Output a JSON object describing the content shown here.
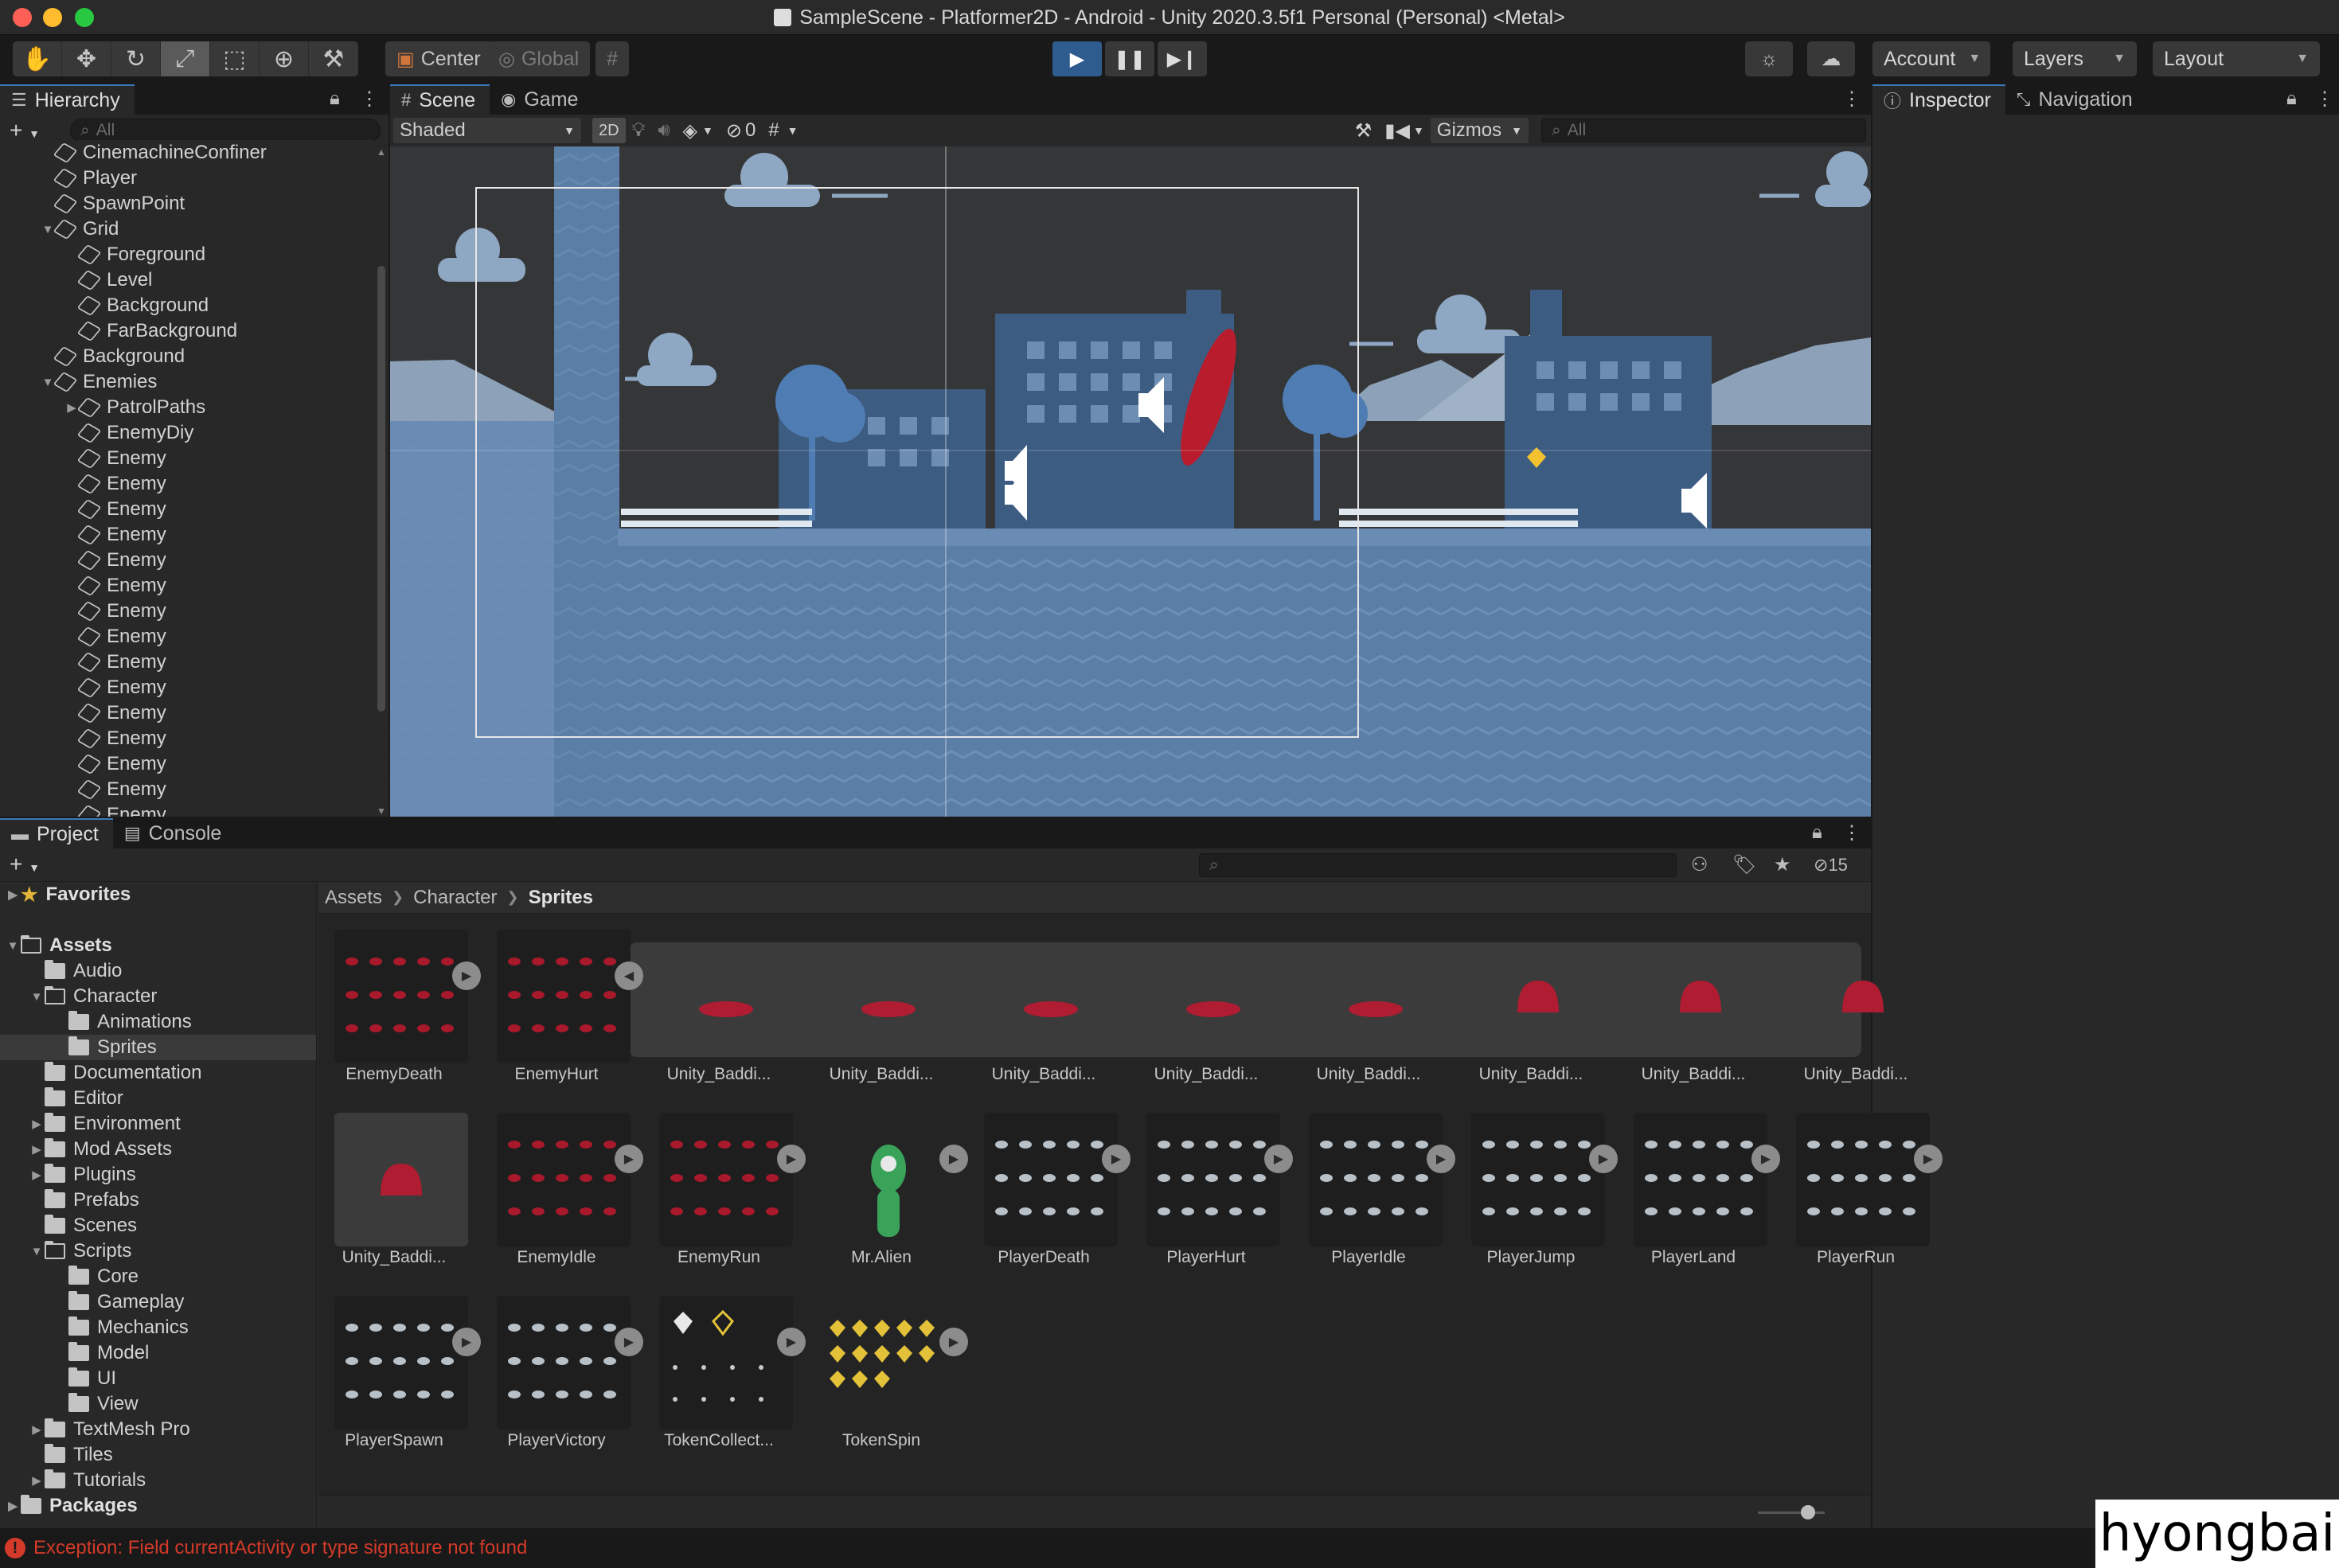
{
  "window": {
    "title": "SampleScene - Platformer2D - Android - Unity 2020.3.5f1 Personal (Personal) <Metal>"
  },
  "toolbar": {
    "center_label": "Center",
    "global_label": "Global",
    "account_label": "Account",
    "layers_label": "Layers",
    "layout_label": "Layout"
  },
  "hierarchy": {
    "tab_label": "Hierarchy",
    "search_placeholder": "All",
    "items": [
      {
        "label": "CinemachineConfiner",
        "depth": 1,
        "arrow": ""
      },
      {
        "label": "Player",
        "depth": 1,
        "arrow": ""
      },
      {
        "label": "SpawnPoint",
        "depth": 1,
        "arrow": ""
      },
      {
        "label": "Grid",
        "depth": 1,
        "arrow": "▼"
      },
      {
        "label": "Foreground",
        "depth": 2,
        "arrow": ""
      },
      {
        "label": "Level",
        "depth": 2,
        "arrow": ""
      },
      {
        "label": "Background",
        "depth": 2,
        "arrow": ""
      },
      {
        "label": "FarBackground",
        "depth": 2,
        "arrow": ""
      },
      {
        "label": "Background",
        "depth": 1,
        "arrow": ""
      },
      {
        "label": "Enemies",
        "depth": 1,
        "arrow": "▼"
      },
      {
        "label": "PatrolPaths",
        "depth": 2,
        "arrow": "▶"
      },
      {
        "label": "EnemyDiy",
        "depth": 2,
        "arrow": ""
      },
      {
        "label": "Enemy",
        "depth": 2,
        "arrow": ""
      },
      {
        "label": "Enemy",
        "depth": 2,
        "arrow": ""
      },
      {
        "label": "Enemy",
        "depth": 2,
        "arrow": ""
      },
      {
        "label": "Enemy",
        "depth": 2,
        "arrow": ""
      },
      {
        "label": "Enemy",
        "depth": 2,
        "arrow": ""
      },
      {
        "label": "Enemy",
        "depth": 2,
        "arrow": ""
      },
      {
        "label": "Enemy",
        "depth": 2,
        "arrow": ""
      },
      {
        "label": "Enemy",
        "depth": 2,
        "arrow": ""
      },
      {
        "label": "Enemy",
        "depth": 2,
        "arrow": ""
      },
      {
        "label": "Enemy",
        "depth": 2,
        "arrow": ""
      },
      {
        "label": "Enemy",
        "depth": 2,
        "arrow": ""
      },
      {
        "label": "Enemy",
        "depth": 2,
        "arrow": ""
      },
      {
        "label": "Enemy",
        "depth": 2,
        "arrow": ""
      },
      {
        "label": "Enemy",
        "depth": 2,
        "arrow": ""
      },
      {
        "label": "Enemy",
        "depth": 2,
        "arrow": ""
      }
    ]
  },
  "scene": {
    "tabs": [
      {
        "label": "Scene",
        "icon": "grid-icon"
      },
      {
        "label": "Game",
        "icon": "gamepad-icon"
      }
    ],
    "shading_mode": "Shaded",
    "mode_2d": "2D",
    "hidden_count": "0",
    "gizmos_label": "Gizmos",
    "search_placeholder": "All"
  },
  "inspector": {
    "tabs": [
      {
        "label": "Inspector",
        "icon": "info-icon"
      },
      {
        "label": "Navigation",
        "icon": "navigation-icon"
      }
    ]
  },
  "project": {
    "tabs": [
      {
        "label": "Project",
        "icon": "folder-icon"
      },
      {
        "label": "Console",
        "icon": "console-icon"
      }
    ],
    "hidden_count": "15",
    "tree": [
      {
        "label": "Favorites",
        "depth": 0,
        "arrow": "▶",
        "kind": "star",
        "bold": true
      },
      {
        "label": "",
        "depth": 0,
        "arrow": "",
        "kind": "spacer",
        "bold": false
      },
      {
        "label": "Assets",
        "depth": 0,
        "arrow": "▼",
        "kind": "open",
        "bold": true
      },
      {
        "label": "Audio",
        "depth": 1,
        "arrow": "",
        "kind": "folder",
        "bold": false
      },
      {
        "label": "Character",
        "depth": 1,
        "arrow": "▼",
        "kind": "open",
        "bold": false
      },
      {
        "label": "Animations",
        "depth": 2,
        "arrow": "",
        "kind": "folder",
        "bold": false
      },
      {
        "label": "Sprites",
        "depth": 2,
        "arrow": "",
        "kind": "folder",
        "bold": false,
        "selected": true
      },
      {
        "label": "Documentation",
        "depth": 1,
        "arrow": "",
        "kind": "folder",
        "bold": false
      },
      {
        "label": "Editor",
        "depth": 1,
        "arrow": "",
        "kind": "folder",
        "bold": false
      },
      {
        "label": "Environment",
        "depth": 1,
        "arrow": "▶",
        "kind": "folder",
        "bold": false
      },
      {
        "label": "Mod Assets",
        "depth": 1,
        "arrow": "▶",
        "kind": "folder",
        "bold": false
      },
      {
        "label": "Plugins",
        "depth": 1,
        "arrow": "▶",
        "kind": "folder",
        "bold": false
      },
      {
        "label": "Prefabs",
        "depth": 1,
        "arrow": "",
        "kind": "folder",
        "bold": false
      },
      {
        "label": "Scenes",
        "depth": 1,
        "arrow": "",
        "kind": "folder",
        "bold": false
      },
      {
        "label": "Scripts",
        "depth": 1,
        "arrow": "▼",
        "kind": "open",
        "bold": false
      },
      {
        "label": "Core",
        "depth": 2,
        "arrow": "",
        "kind": "folder",
        "bold": false
      },
      {
        "label": "Gameplay",
        "depth": 2,
        "arrow": "",
        "kind": "folder",
        "bold": false
      },
      {
        "label": "Mechanics",
        "depth": 2,
        "arrow": "",
        "kind": "folder",
        "bold": false
      },
      {
        "label": "Model",
        "depth": 2,
        "arrow": "",
        "kind": "folder",
        "bold": false
      },
      {
        "label": "UI",
        "depth": 2,
        "arrow": "",
        "kind": "folder",
        "bold": false
      },
      {
        "label": "View",
        "depth": 2,
        "arrow": "",
        "kind": "folder",
        "bold": false
      },
      {
        "label": "TextMesh Pro",
        "depth": 1,
        "arrow": "▶",
        "kind": "folder",
        "bold": false
      },
      {
        "label": "Tiles",
        "depth": 1,
        "arrow": "",
        "kind": "folder",
        "bold": false
      },
      {
        "label": "Tutorials",
        "depth": 1,
        "arrow": "▶",
        "kind": "folder",
        "bold": false
      },
      {
        "label": "Packages",
        "depth": 0,
        "arrow": "▶",
        "kind": "folder",
        "bold": true
      }
    ],
    "breadcrumb": [
      "Assets",
      "Character",
      "Sprites"
    ],
    "assets": [
      {
        "label": "EnemyDeath",
        "thumb": "sheet-red",
        "play": "right"
      },
      {
        "label": "EnemyHurt",
        "thumb": "sheet-red",
        "play": "left"
      },
      {
        "label": "Unity_Baddi...",
        "thumb": "blob-flat",
        "play": ""
      },
      {
        "label": "Unity_Baddi...",
        "thumb": "blob-flat",
        "play": ""
      },
      {
        "label": "Unity_Baddi...",
        "thumb": "blob-flat",
        "play": ""
      },
      {
        "label": "Unity_Baddi...",
        "thumb": "blob-flat",
        "play": ""
      },
      {
        "label": "Unity_Baddi...",
        "thumb": "blob-flat",
        "play": ""
      },
      {
        "label": "Unity_Baddi...",
        "thumb": "blob-round",
        "play": ""
      },
      {
        "label": "Unity_Baddi...",
        "thumb": "blob-round",
        "play": ""
      },
      {
        "label": "Unity_Baddi...",
        "thumb": "blob-round",
        "play": ""
      },
      {
        "label": "Unity_Baddi...",
        "thumb": "blob-round-sel",
        "play": ""
      },
      {
        "label": "EnemyIdle",
        "thumb": "sheet-red",
        "play": "right"
      },
      {
        "label": "EnemyRun",
        "thumb": "sheet-red",
        "play": "right"
      },
      {
        "label": "Mr.Alien",
        "thumb": "alien",
        "play": "right"
      },
      {
        "label": "PlayerDeath",
        "thumb": "sheet-gray",
        "play": "right"
      },
      {
        "label": "PlayerHurt",
        "thumb": "sheet-gray",
        "play": "right"
      },
      {
        "label": "PlayerIdle",
        "thumb": "sheet-gray",
        "play": "right"
      },
      {
        "label": "PlayerJump",
        "thumb": "sheet-gray",
        "play": "right"
      },
      {
        "label": "PlayerLand",
        "thumb": "sheet-gray",
        "play": "right"
      },
      {
        "label": "PlayerRun",
        "thumb": "sheet-gray",
        "play": "right"
      },
      {
        "label": "PlayerSpawn",
        "thumb": "sheet-gray",
        "play": "right"
      },
      {
        "label": "PlayerVictory",
        "thumb": "sheet-gray",
        "play": "right"
      },
      {
        "label": "TokenCollect...",
        "thumb": "token-collect",
        "play": "right"
      },
      {
        "label": "TokenSpin",
        "thumb": "token-spin",
        "play": "right"
      }
    ]
  },
  "status": {
    "message": "Exception: Field currentActivity or type signature  not found"
  },
  "watermark": "hyongbai",
  "colors": {
    "accent": "#3a79bb",
    "error": "#d33a2a",
    "sky": "#353638",
    "water": "#5a7ea6"
  }
}
